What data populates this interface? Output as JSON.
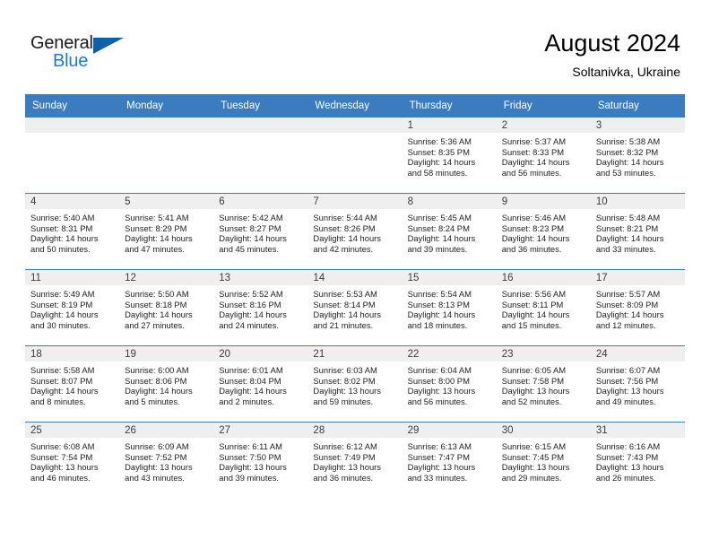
{
  "brand": {
    "name_part1": "General",
    "name_part2": "Blue",
    "logo_icon": "triangle-logo-icon",
    "accent_color": "#1e7ac4"
  },
  "header": {
    "title": "August 2024",
    "subtitle": "Soltanivka, Ukraine"
  },
  "theme": {
    "header_row_bg": "#3a7cbe",
    "daynum_band_bg": "#efefef",
    "row_divider": "#3a7cbe"
  },
  "weekday_headers": [
    "Sunday",
    "Monday",
    "Tuesday",
    "Wednesday",
    "Thursday",
    "Friday",
    "Saturday"
  ],
  "weeks": [
    [
      {
        "day": "",
        "sunrise": "",
        "sunset": "",
        "daylight_line1": "",
        "daylight_line2": ""
      },
      {
        "day": "",
        "sunrise": "",
        "sunset": "",
        "daylight_line1": "",
        "daylight_line2": ""
      },
      {
        "day": "",
        "sunrise": "",
        "sunset": "",
        "daylight_line1": "",
        "daylight_line2": ""
      },
      {
        "day": "",
        "sunrise": "",
        "sunset": "",
        "daylight_line1": "",
        "daylight_line2": ""
      },
      {
        "day": "1",
        "sunrise": "Sunrise: 5:36 AM",
        "sunset": "Sunset: 8:35 PM",
        "daylight_line1": "Daylight: 14 hours",
        "daylight_line2": "and 58 minutes."
      },
      {
        "day": "2",
        "sunrise": "Sunrise: 5:37 AM",
        "sunset": "Sunset: 8:33 PM",
        "daylight_line1": "Daylight: 14 hours",
        "daylight_line2": "and 56 minutes."
      },
      {
        "day": "3",
        "sunrise": "Sunrise: 5:38 AM",
        "sunset": "Sunset: 8:32 PM",
        "daylight_line1": "Daylight: 14 hours",
        "daylight_line2": "and 53 minutes."
      }
    ],
    [
      {
        "day": "4",
        "sunrise": "Sunrise: 5:40 AM",
        "sunset": "Sunset: 8:31 PM",
        "daylight_line1": "Daylight: 14 hours",
        "daylight_line2": "and 50 minutes."
      },
      {
        "day": "5",
        "sunrise": "Sunrise: 5:41 AM",
        "sunset": "Sunset: 8:29 PM",
        "daylight_line1": "Daylight: 14 hours",
        "daylight_line2": "and 47 minutes."
      },
      {
        "day": "6",
        "sunrise": "Sunrise: 5:42 AM",
        "sunset": "Sunset: 8:27 PM",
        "daylight_line1": "Daylight: 14 hours",
        "daylight_line2": "and 45 minutes."
      },
      {
        "day": "7",
        "sunrise": "Sunrise: 5:44 AM",
        "sunset": "Sunset: 8:26 PM",
        "daylight_line1": "Daylight: 14 hours",
        "daylight_line2": "and 42 minutes."
      },
      {
        "day": "8",
        "sunrise": "Sunrise: 5:45 AM",
        "sunset": "Sunset: 8:24 PM",
        "daylight_line1": "Daylight: 14 hours",
        "daylight_line2": "and 39 minutes."
      },
      {
        "day": "9",
        "sunrise": "Sunrise: 5:46 AM",
        "sunset": "Sunset: 8:23 PM",
        "daylight_line1": "Daylight: 14 hours",
        "daylight_line2": "and 36 minutes."
      },
      {
        "day": "10",
        "sunrise": "Sunrise: 5:48 AM",
        "sunset": "Sunset: 8:21 PM",
        "daylight_line1": "Daylight: 14 hours",
        "daylight_line2": "and 33 minutes."
      }
    ],
    [
      {
        "day": "11",
        "sunrise": "Sunrise: 5:49 AM",
        "sunset": "Sunset: 8:19 PM",
        "daylight_line1": "Daylight: 14 hours",
        "daylight_line2": "and 30 minutes."
      },
      {
        "day": "12",
        "sunrise": "Sunrise: 5:50 AM",
        "sunset": "Sunset: 8:18 PM",
        "daylight_line1": "Daylight: 14 hours",
        "daylight_line2": "and 27 minutes."
      },
      {
        "day": "13",
        "sunrise": "Sunrise: 5:52 AM",
        "sunset": "Sunset: 8:16 PM",
        "daylight_line1": "Daylight: 14 hours",
        "daylight_line2": "and 24 minutes."
      },
      {
        "day": "14",
        "sunrise": "Sunrise: 5:53 AM",
        "sunset": "Sunset: 8:14 PM",
        "daylight_line1": "Daylight: 14 hours",
        "daylight_line2": "and 21 minutes."
      },
      {
        "day": "15",
        "sunrise": "Sunrise: 5:54 AM",
        "sunset": "Sunset: 8:13 PM",
        "daylight_line1": "Daylight: 14 hours",
        "daylight_line2": "and 18 minutes."
      },
      {
        "day": "16",
        "sunrise": "Sunrise: 5:56 AM",
        "sunset": "Sunset: 8:11 PM",
        "daylight_line1": "Daylight: 14 hours",
        "daylight_line2": "and 15 minutes."
      },
      {
        "day": "17",
        "sunrise": "Sunrise: 5:57 AM",
        "sunset": "Sunset: 8:09 PM",
        "daylight_line1": "Daylight: 14 hours",
        "daylight_line2": "and 12 minutes."
      }
    ],
    [
      {
        "day": "18",
        "sunrise": "Sunrise: 5:58 AM",
        "sunset": "Sunset: 8:07 PM",
        "daylight_line1": "Daylight: 14 hours",
        "daylight_line2": "and 8 minutes."
      },
      {
        "day": "19",
        "sunrise": "Sunrise: 6:00 AM",
        "sunset": "Sunset: 8:06 PM",
        "daylight_line1": "Daylight: 14 hours",
        "daylight_line2": "and 5 minutes."
      },
      {
        "day": "20",
        "sunrise": "Sunrise: 6:01 AM",
        "sunset": "Sunset: 8:04 PM",
        "daylight_line1": "Daylight: 14 hours",
        "daylight_line2": "and 2 minutes."
      },
      {
        "day": "21",
        "sunrise": "Sunrise: 6:03 AM",
        "sunset": "Sunset: 8:02 PM",
        "daylight_line1": "Daylight: 13 hours",
        "daylight_line2": "and 59 minutes."
      },
      {
        "day": "22",
        "sunrise": "Sunrise: 6:04 AM",
        "sunset": "Sunset: 8:00 PM",
        "daylight_line1": "Daylight: 13 hours",
        "daylight_line2": "and 56 minutes."
      },
      {
        "day": "23",
        "sunrise": "Sunrise: 6:05 AM",
        "sunset": "Sunset: 7:58 PM",
        "daylight_line1": "Daylight: 13 hours",
        "daylight_line2": "and 52 minutes."
      },
      {
        "day": "24",
        "sunrise": "Sunrise: 6:07 AM",
        "sunset": "Sunset: 7:56 PM",
        "daylight_line1": "Daylight: 13 hours",
        "daylight_line2": "and 49 minutes."
      }
    ],
    [
      {
        "day": "25",
        "sunrise": "Sunrise: 6:08 AM",
        "sunset": "Sunset: 7:54 PM",
        "daylight_line1": "Daylight: 13 hours",
        "daylight_line2": "and 46 minutes."
      },
      {
        "day": "26",
        "sunrise": "Sunrise: 6:09 AM",
        "sunset": "Sunset: 7:52 PM",
        "daylight_line1": "Daylight: 13 hours",
        "daylight_line2": "and 43 minutes."
      },
      {
        "day": "27",
        "sunrise": "Sunrise: 6:11 AM",
        "sunset": "Sunset: 7:50 PM",
        "daylight_line1": "Daylight: 13 hours",
        "daylight_line2": "and 39 minutes."
      },
      {
        "day": "28",
        "sunrise": "Sunrise: 6:12 AM",
        "sunset": "Sunset: 7:49 PM",
        "daylight_line1": "Daylight: 13 hours",
        "daylight_line2": "and 36 minutes."
      },
      {
        "day": "29",
        "sunrise": "Sunrise: 6:13 AM",
        "sunset": "Sunset: 7:47 PM",
        "daylight_line1": "Daylight: 13 hours",
        "daylight_line2": "and 33 minutes."
      },
      {
        "day": "30",
        "sunrise": "Sunrise: 6:15 AM",
        "sunset": "Sunset: 7:45 PM",
        "daylight_line1": "Daylight: 13 hours",
        "daylight_line2": "and 29 minutes."
      },
      {
        "day": "31",
        "sunrise": "Sunrise: 6:16 AM",
        "sunset": "Sunset: 7:43 PM",
        "daylight_line1": "Daylight: 13 hours",
        "daylight_line2": "and 26 minutes."
      }
    ]
  ]
}
